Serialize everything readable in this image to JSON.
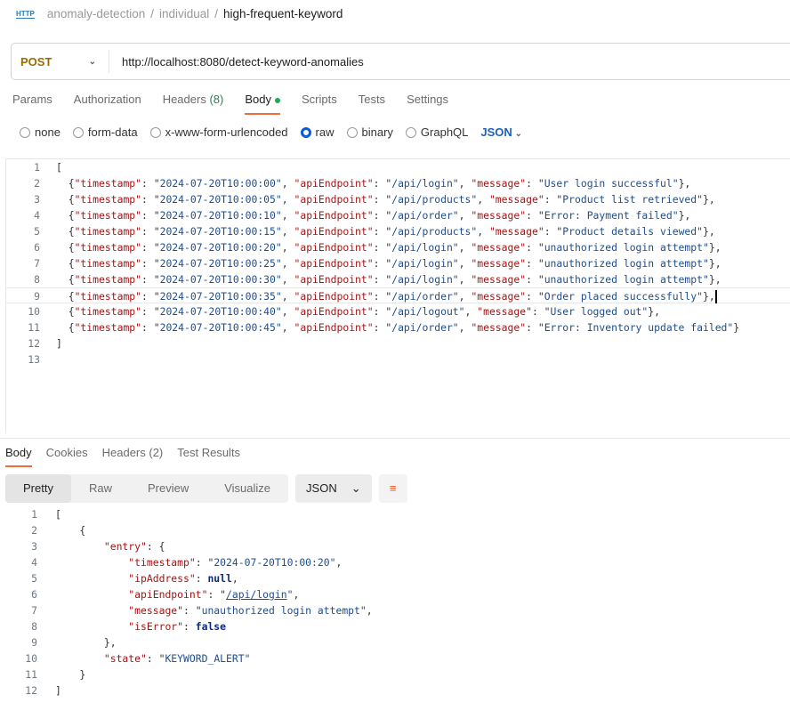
{
  "breadcrumb": {
    "icon": "http-icon",
    "items": [
      "anomaly-detection",
      "individual"
    ],
    "current": "high-frequent-keyword"
  },
  "request": {
    "method": "POST",
    "url": "http://localhost:8080/detect-keyword-anomalies"
  },
  "tabs": {
    "params": "Params",
    "authorization": "Authorization",
    "headers": "Headers",
    "headers_count": "(8)",
    "body": "Body",
    "scripts": "Scripts",
    "tests": "Tests",
    "settings": "Settings"
  },
  "body_types": {
    "options": [
      "none",
      "form-data",
      "x-www-form-urlencoded",
      "raw",
      "binary",
      "GraphQL"
    ],
    "selected": "raw",
    "format": "JSON"
  },
  "request_body": [
    {
      "timestamp": "2024-07-20T10:00:00",
      "apiEndpoint": "/api/login",
      "message": "User login successful"
    },
    {
      "timestamp": "2024-07-20T10:00:05",
      "apiEndpoint": "/api/products",
      "message": "Product list retrieved"
    },
    {
      "timestamp": "2024-07-20T10:00:10",
      "apiEndpoint": "/api/order",
      "message": "Error: Payment failed"
    },
    {
      "timestamp": "2024-07-20T10:00:15",
      "apiEndpoint": "/api/products",
      "message": "Product details viewed"
    },
    {
      "timestamp": "2024-07-20T10:00:20",
      "apiEndpoint": "/api/login",
      "message": "unauthorized login attempt"
    },
    {
      "timestamp": "2024-07-20T10:00:25",
      "apiEndpoint": "/api/login",
      "message": "unauthorized login attempt"
    },
    {
      "timestamp": "2024-07-20T10:00:30",
      "apiEndpoint": "/api/login",
      "message": "unauthorized login attempt"
    },
    {
      "timestamp": "2024-07-20T10:00:35",
      "apiEndpoint": "/api/order",
      "message": "Order placed successfully"
    },
    {
      "timestamp": "2024-07-20T10:00:40",
      "apiEndpoint": "/api/logout",
      "message": "User logged out"
    },
    {
      "timestamp": "2024-07-20T10:00:45",
      "apiEndpoint": "/api/order",
      "message": "Error: Inventory update failed"
    }
  ],
  "response_tabs": {
    "body": "Body",
    "cookies": "Cookies",
    "headers": "Headers (2)",
    "tests": "Test Results"
  },
  "view_modes": {
    "pretty": "Pretty",
    "raw": "Raw",
    "preview": "Preview",
    "visualize": "Visualize",
    "format": "JSON",
    "wrap_icon": "wrap-lines-icon"
  },
  "response": {
    "entry": {
      "timestamp": "2024-07-20T10:00:20",
      "ipAddress": "null",
      "apiEndpoint": "/api/login",
      "message": "unauthorized login attempt",
      "isError": "false"
    },
    "state": "KEYWORD_ALERT"
  }
}
